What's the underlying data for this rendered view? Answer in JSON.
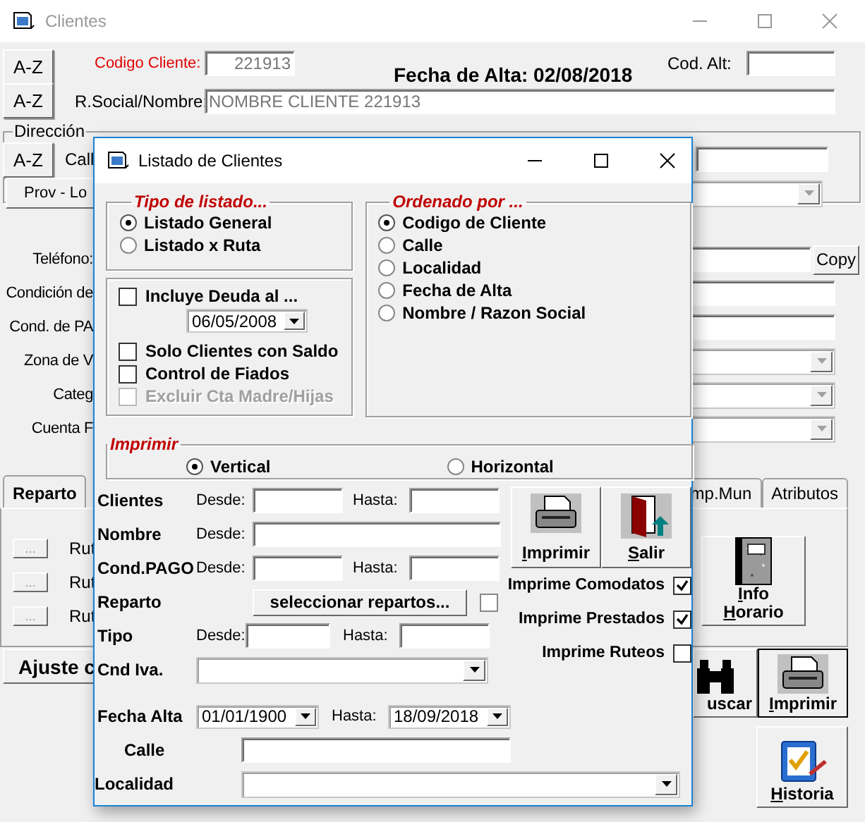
{
  "window": {
    "title": "Clientes"
  },
  "header": {
    "codigo_label": "Codigo Cliente:",
    "codigo_value": "221913",
    "fecha_alta": "Fecha de Alta: 02/08/2018",
    "cod_alt_label": "Cod. Alt:",
    "razon_label": "R.Social/Nombre:",
    "razon_value": "NOMBRE CLIENTE 221913"
  },
  "az_buttons": [
    "A-Z",
    "A-Z",
    "A-Z"
  ],
  "direccion": {
    "legend": "Dirección",
    "calle_label": "Call",
    "prov_label": "Prov - Lo"
  },
  "side_fields": [
    {
      "label": "Teléfono:",
      "kind": "copy",
      "button": "Copy"
    },
    {
      "label": "Condición de",
      "kind": "text"
    },
    {
      "label": "Cond. de PA",
      "kind": "text"
    },
    {
      "label": "Zona de V",
      "kind": "combo"
    },
    {
      "label": "Categ",
      "kind": "combo"
    },
    {
      "label": "Cuenta F",
      "kind": "combo"
    }
  ],
  "tabs": [
    {
      "label": "Reparto",
      "selected": true
    },
    {
      "label": "mp.Mun",
      "selected": false
    },
    {
      "label": "Atributos",
      "selected": false
    }
  ],
  "rutas": [
    {
      "button": "...",
      "label": "Rut"
    },
    {
      "button": "...",
      "label": "Rut"
    },
    {
      "button": "...",
      "label": "Rut"
    }
  ],
  "info_button": {
    "lines": [
      "Info",
      "Horario"
    ]
  },
  "ajuste_button": "Ajuste c",
  "buscar_button": "uscar",
  "imprimir_button": "Imprimir",
  "historia_button": "Historia",
  "dialog": {
    "title": "Listado de Clientes",
    "tipo": {
      "legend": "Tipo de listado...",
      "options": [
        {
          "label": "Listado General",
          "selected": true
        },
        {
          "label": "Listado x Ruta",
          "selected": false
        }
      ]
    },
    "opciones": [
      {
        "kind": "check",
        "label": "Incluye Deuda al ...",
        "checked": false,
        "disabled": false
      },
      {
        "kind": "date",
        "value": "06/05/2008"
      },
      {
        "kind": "check",
        "label": "Solo Clientes con Saldo",
        "checked": false,
        "disabled": false
      },
      {
        "kind": "check",
        "label": "Control de Fiados",
        "checked": false,
        "disabled": false
      },
      {
        "kind": "check",
        "label": "Excluir Cta Madre/Hijas",
        "checked": false,
        "disabled": true
      }
    ],
    "orden": {
      "legend": "Ordenado por ...",
      "options": [
        {
          "label": "Codigo de Cliente",
          "selected": true
        },
        {
          "label": "Calle",
          "selected": false
        },
        {
          "label": "Localidad",
          "selected": false
        },
        {
          "label": "Fecha de Alta",
          "selected": false
        },
        {
          "label": "Nombre / Razon Social",
          "selected": false
        }
      ]
    },
    "imprimir": {
      "legend": "Imprimir",
      "options": [
        {
          "label": "Vertical",
          "selected": true
        },
        {
          "label": "Horizontal",
          "selected": false
        }
      ]
    },
    "filters": [
      {
        "label": "Clientes",
        "kind": "range",
        "from_label": "Desde:",
        "to_label": "Hasta:"
      },
      {
        "label": "Nombre",
        "kind": "from",
        "from_label": "Desde:"
      },
      {
        "label": "Cond.PAGO",
        "kind": "range",
        "from_label": "Desde:",
        "to_label": "Hasta:"
      },
      {
        "label": "Reparto",
        "kind": "button",
        "button": "seleccionar repartos...",
        "checked": false
      },
      {
        "label": "Tipo",
        "kind": "range_narrow",
        "from_label": "Desde:",
        "to_label": "Hasta:"
      },
      {
        "label": "Cnd Iva.",
        "kind": "combo"
      }
    ],
    "actions": [
      {
        "label": "Imprimir",
        "kind": "print"
      },
      {
        "label": "Salir",
        "kind": "exit"
      }
    ],
    "print_checks": [
      {
        "label": "Imprime Comodatos",
        "checked": true
      },
      {
        "label": "Imprime Prestados",
        "checked": true
      },
      {
        "label": "Imprime Ruteos",
        "checked": false
      }
    ],
    "fecha_alta": {
      "label": "Fecha Alta",
      "from": "01/01/1900",
      "to_label": "Hasta:",
      "to": "18/09/2018"
    },
    "calle_label": "Calle",
    "localidad_label": "Localidad"
  }
}
